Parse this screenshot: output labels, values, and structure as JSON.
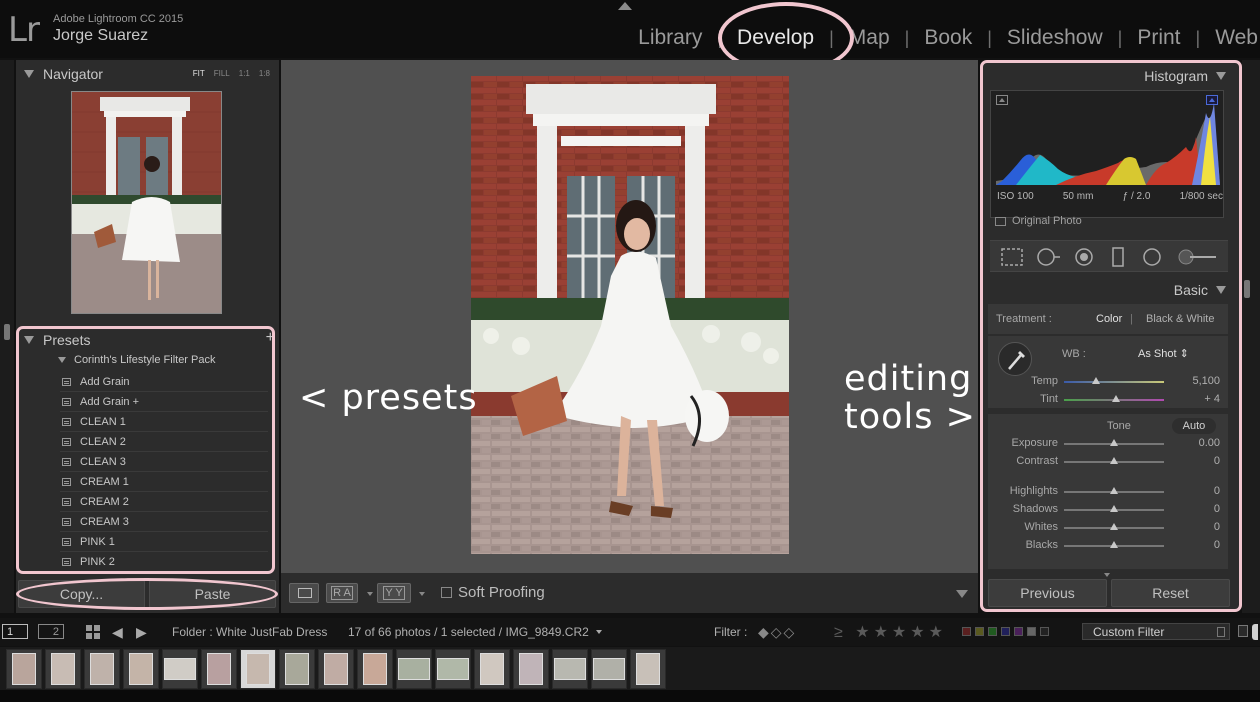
{
  "app": {
    "logo": "Lr",
    "product": "Adobe Lightroom CC 2015",
    "user": "Jorge Suarez"
  },
  "modules": [
    {
      "label": "Library",
      "active": false
    },
    {
      "label": "Develop",
      "active": true
    },
    {
      "label": "Map",
      "active": false
    },
    {
      "label": "Book",
      "active": false
    },
    {
      "label": "Slideshow",
      "active": false
    },
    {
      "label": "Print",
      "active": false
    },
    {
      "label": "Web",
      "active": false
    }
  ],
  "module_separator": "|",
  "navigator": {
    "title": "Navigator",
    "zoom_options": [
      "FIT",
      "FILL",
      "1:1",
      "1:8"
    ],
    "zoom_selected": "FIT"
  },
  "presets": {
    "title": "Presets",
    "add_icon": "+",
    "folder": "Corinth's Lifestyle Filter Pack",
    "items": [
      "Add Grain",
      "Add Grain +",
      "CLEAN 1",
      "CLEAN 2",
      "CLEAN 3",
      "CREAM 1",
      "CREAM 2",
      "CREAM 3",
      "PINK 1",
      "PINK 2"
    ]
  },
  "left_buttons": {
    "copy": "Copy...",
    "paste": "Paste"
  },
  "annotations": {
    "presets": "< presets",
    "editing_line1": "editing",
    "editing_line2": "tools >"
  },
  "toolbar": {
    "compare_ba": "R A",
    "compare_yy": "Y Y",
    "soft_proofing": "Soft Proofing"
  },
  "histogram": {
    "title": "Histogram",
    "iso": "ISO 100",
    "focal": "50 mm",
    "aperture": "ƒ / 2.0",
    "shutter": "1/800 sec",
    "original_photo": "Original Photo"
  },
  "basic": {
    "title": "Basic",
    "treatment_label": "Treatment :",
    "treatment_color": "Color",
    "treatment_separator": "|",
    "treatment_bw": "Black & White",
    "wb_label": "WB :",
    "wb_value": "As Shot",
    "temp_label": "Temp",
    "temp_value": "5,100",
    "temp_position": 0.32,
    "tint_label": "Tint",
    "tint_value": "+ 4",
    "tint_position": 0.52,
    "tone_label": "Tone",
    "auto_label": "Auto",
    "tone_sliders": [
      {
        "label": "Exposure",
        "value": "0.00",
        "position": 0.5
      },
      {
        "label": "Contrast",
        "value": "0",
        "position": 0.5
      },
      {
        "label": "Highlights",
        "value": "0",
        "position": 0.5
      },
      {
        "label": "Shadows",
        "value": "0",
        "position": 0.5
      },
      {
        "label": "Whites",
        "value": "0",
        "position": 0.5
      },
      {
        "label": "Blacks",
        "value": "0",
        "position": 0.5
      }
    ]
  },
  "right_buttons": {
    "previous": "Previous",
    "reset": "Reset"
  },
  "filmbar": {
    "screen1": "1",
    "screen2": "2",
    "back_icon": "◀",
    "forward_icon": "▶",
    "folder": "Folder : White JustFab Dress",
    "count": "17 of 66 photos / 1 selected / IMG_9849.CR2",
    "filter_label": "Filter :",
    "flags": "◆◇◇",
    "stars": "≥ ★★★★★",
    "custom_filter": "Custom Filter"
  },
  "colors": {
    "accent_annotation": "#f1c6cf",
    "panel_bg": "#2c2c2c",
    "center_bg": "#505050",
    "top_bg": "#0d0d0d"
  },
  "filmstrip": {
    "count": 17,
    "selected_index": 6
  }
}
